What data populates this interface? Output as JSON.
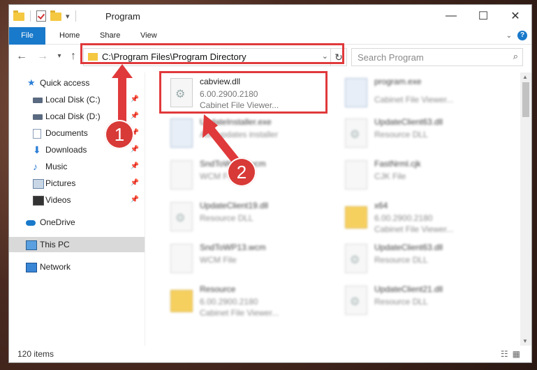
{
  "window": {
    "title": "Program"
  },
  "ribbon": {
    "tabs": [
      "File",
      "Home",
      "Share",
      "View"
    ]
  },
  "controls": {
    "minimize": "—",
    "maximize": "☐",
    "close": "✕",
    "help": "?"
  },
  "address": {
    "path": "C:\\Program Files\\Program Directory"
  },
  "search": {
    "placeholder": "Search Program"
  },
  "sidebar": {
    "items": [
      {
        "label": "Quick access"
      },
      {
        "label": "Local Disk (C:)"
      },
      {
        "label": "Local Disk (D:)"
      },
      {
        "label": "Documents"
      },
      {
        "label": "Downloads"
      },
      {
        "label": "Music"
      },
      {
        "label": "Pictures"
      },
      {
        "label": "Videos"
      },
      {
        "label": "OneDrive"
      },
      {
        "label": "This PC"
      },
      {
        "label": "Network"
      }
    ]
  },
  "files": [
    {
      "name": "cabview.dll",
      "line1": "6.00.2900.2180",
      "line2": "Cabinet File Viewer..."
    },
    {
      "name": "program.exe",
      "line1": "Cabinet File Viewer...",
      "line2": ""
    },
    {
      "name": "UpdateInstaller.exe",
      "line1": "Add updates installer",
      "line2": ""
    },
    {
      "name": "UpdateClient63.dll",
      "line1": "Resource DLL",
      "line2": ""
    },
    {
      "name": "SndToWP13.wcm",
      "line1": "WCM File",
      "line2": ""
    },
    {
      "name": "FastNrml.cjk",
      "line1": "CJK File",
      "line2": ""
    },
    {
      "name": "UpdateClient19.dll",
      "line1": "Resource DLL",
      "line2": ""
    },
    {
      "name": "x64",
      "line1": "6.00.2900.2180",
      "line2": "Cabinet File Viewer..."
    },
    {
      "name": "SndToWP13.wcm",
      "line1": "WCM File",
      "line2": ""
    },
    {
      "name": "UpdateClient63.dll",
      "line1": "Resource DLL",
      "line2": ""
    },
    {
      "name": "Resource",
      "line1": "6.00.2900.2180",
      "line2": "Cabinet File Viewer..."
    },
    {
      "name": "UpdateClient21.dll",
      "line1": "Resource DLL",
      "line2": ""
    }
  ],
  "annotations": {
    "step1": "1",
    "step2": "2",
    "highlight_color": "#e0393b"
  },
  "status": {
    "item_count": "120 items"
  },
  "colors": {
    "accent": "#1979ca"
  }
}
